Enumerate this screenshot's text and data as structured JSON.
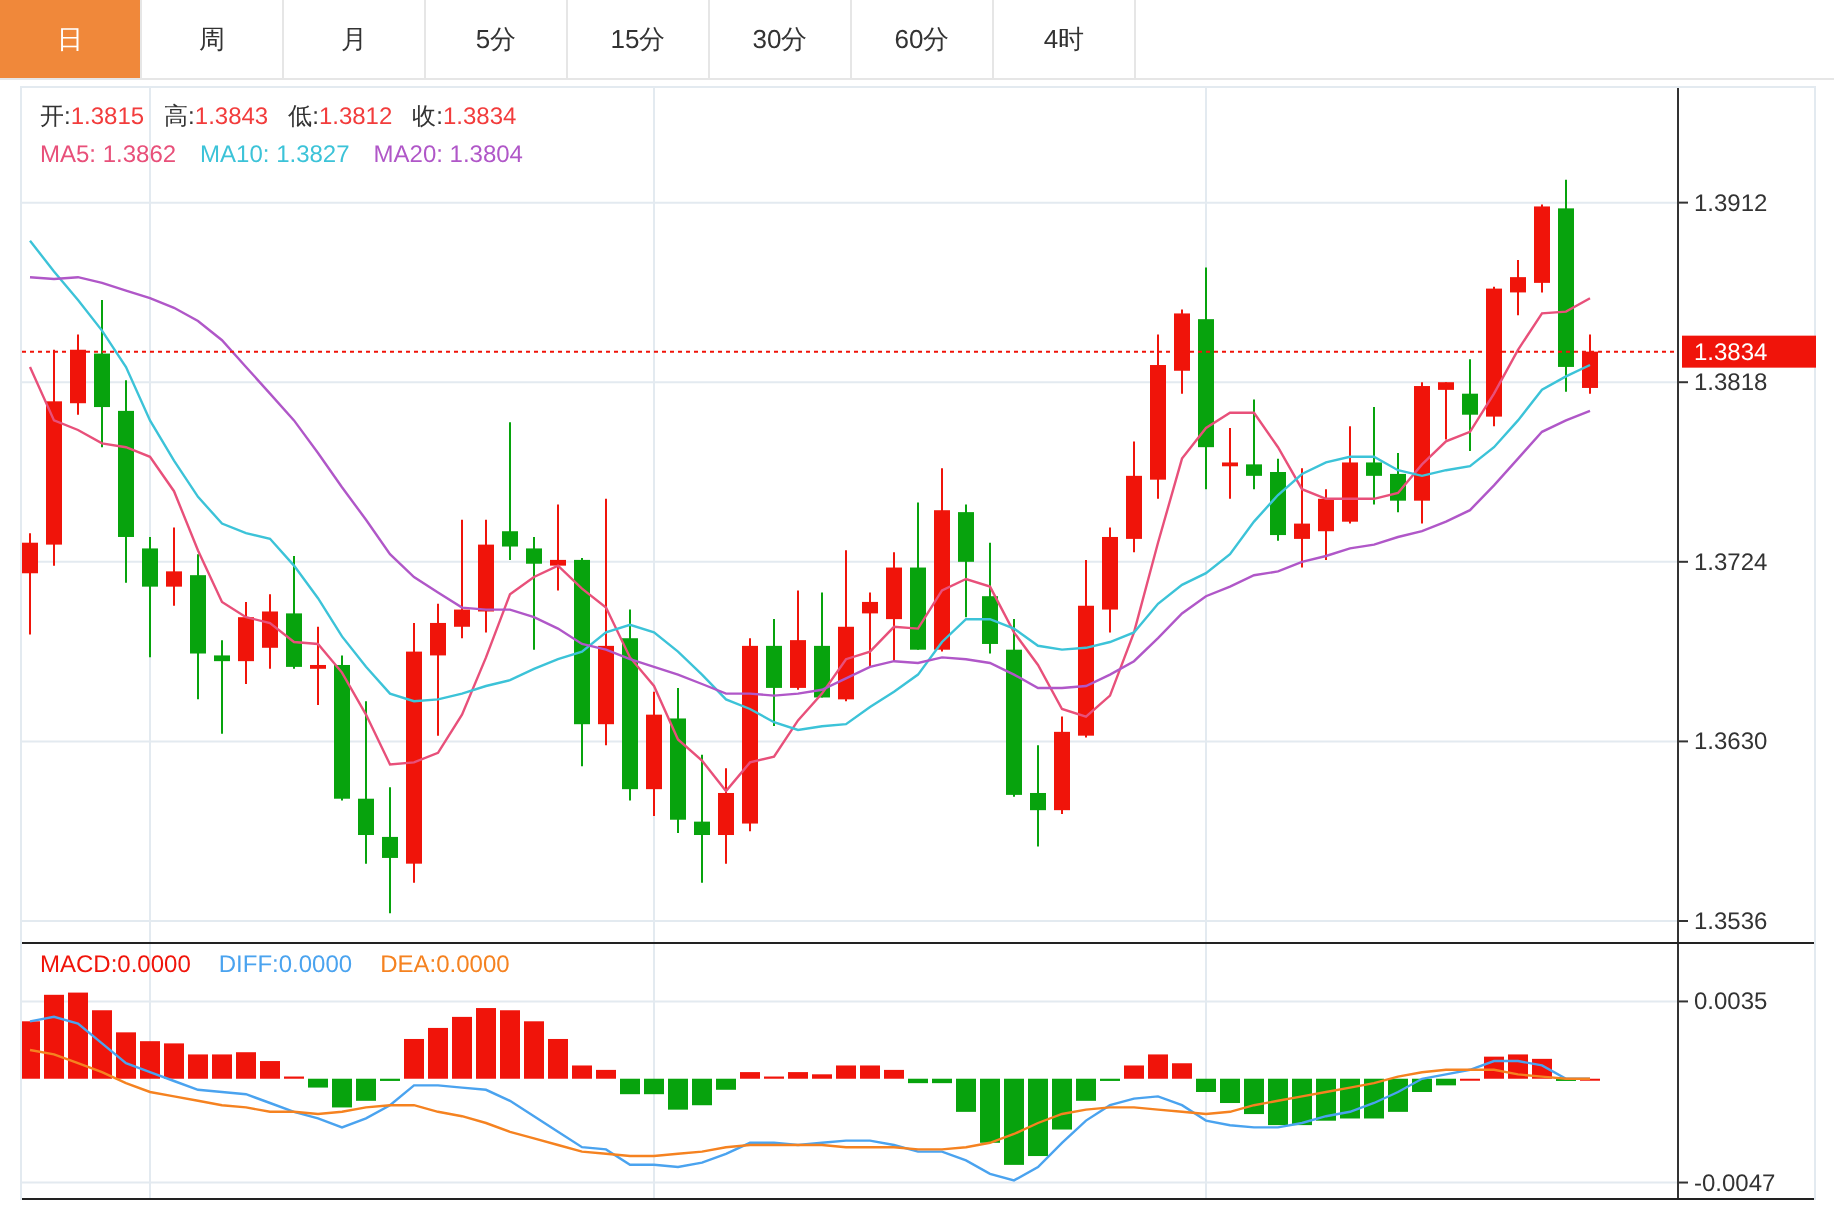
{
  "tabs": [
    {
      "label": "日",
      "selected": true
    },
    {
      "label": "周",
      "selected": false
    },
    {
      "label": "月",
      "selected": false
    },
    {
      "label": "5分",
      "selected": false
    },
    {
      "label": "15分",
      "selected": false
    },
    {
      "label": "30分",
      "selected": false
    },
    {
      "label": "60分",
      "selected": false
    },
    {
      "label": "4时",
      "selected": false
    }
  ],
  "main_chart": {
    "legend": {
      "ohlc": [
        {
          "label": "开:",
          "value": "1.3815"
        },
        {
          "label": "高:",
          "value": "1.3843"
        },
        {
          "label": "低:",
          "value": "1.3812"
        },
        {
          "label": "收:",
          "value": "1.3834"
        }
      ],
      "ma": [
        {
          "text": "MA5: 1.3862"
        },
        {
          "text": "MA10: 1.3827"
        },
        {
          "text": "MA20: 1.3804"
        }
      ]
    },
    "chart_data": {
      "type": "candlestick",
      "grid": true,
      "ref_lines": [
        {
          "axis": "y",
          "value": 1.3834,
          "label": "1.3834"
        }
      ],
      "ylim": [
        1.3525,
        1.3972
      ],
      "yticks": [
        {
          "value": 1.3912,
          "label": "1.3912"
        },
        {
          "value": 1.3818,
          "label": "1.3818"
        },
        {
          "value": 1.3724,
          "label": "1.3724"
        },
        {
          "value": 1.363,
          "label": "1.3630"
        },
        {
          "value": 1.3536,
          "label": "1.3536"
        }
      ],
      "ohlc": [
        [
          1.3718,
          1.3739,
          1.3686,
          1.3734
        ],
        [
          1.3733,
          1.3835,
          1.3722,
          1.3808
        ],
        [
          1.3807,
          1.3843,
          1.3801,
          1.3835
        ],
        [
          1.3833,
          1.3861,
          1.3784,
          1.3805
        ],
        [
          1.3803,
          1.3819,
          1.3713,
          1.3737
        ],
        [
          1.3731,
          1.3737,
          1.3674,
          1.3711
        ],
        [
          1.3711,
          1.3742,
          1.3701,
          1.3719
        ],
        [
          1.3717,
          1.3728,
          1.3652,
          1.3676
        ],
        [
          1.3675,
          1.3683,
          1.3634,
          1.3672
        ],
        [
          1.3672,
          1.3703,
          1.366,
          1.3695
        ],
        [
          1.3679,
          1.3707,
          1.3668,
          1.3698
        ],
        [
          1.3697,
          1.3727,
          1.3668,
          1.3669
        ],
        [
          1.3668,
          1.369,
          1.3649,
          1.367
        ],
        [
          1.367,
          1.3675,
          1.3599,
          1.36
        ],
        [
          1.36,
          1.3651,
          1.3566,
          1.3581
        ],
        [
          1.358,
          1.3606,
          1.354,
          1.3569
        ],
        [
          1.3566,
          1.3692,
          1.3556,
          1.3677
        ],
        [
          1.3675,
          1.3702,
          1.3633,
          1.3692
        ],
        [
          1.369,
          1.3746,
          1.3684,
          1.3699
        ],
        [
          1.3698,
          1.3746,
          1.3687,
          1.3733
        ],
        [
          1.374,
          1.3797,
          1.3725,
          1.3732
        ],
        [
          1.3731,
          1.3737,
          1.3678,
          1.3723
        ],
        [
          1.3722,
          1.3754,
          1.3709,
          1.3725
        ],
        [
          1.3725,
          1.3726,
          1.3617,
          1.3639
        ],
        [
          1.3639,
          1.3757,
          1.3628,
          1.368
        ],
        [
          1.3684,
          1.3699,
          1.3599,
          1.3605
        ],
        [
          1.3605,
          1.3656,
          1.3591,
          1.3644
        ],
        [
          1.3642,
          1.3658,
          1.3582,
          1.3589
        ],
        [
          1.3588,
          1.3623,
          1.3556,
          1.3581
        ],
        [
          1.3581,
          1.3616,
          1.3566,
          1.3603
        ],
        [
          1.3587,
          1.3684,
          1.3583,
          1.368
        ],
        [
          1.368,
          1.3694,
          1.3638,
          1.3658
        ],
        [
          1.3658,
          1.3709,
          1.3657,
          1.3683
        ],
        [
          1.368,
          1.3708,
          1.3653,
          1.3653
        ],
        [
          1.3652,
          1.373,
          1.3651,
          1.369
        ],
        [
          1.3697,
          1.3708,
          1.3669,
          1.3703
        ],
        [
          1.3694,
          1.3729,
          1.3672,
          1.3721
        ],
        [
          1.3721,
          1.3755,
          1.3678,
          1.3678
        ],
        [
          1.3678,
          1.3773,
          1.3677,
          1.3751
        ],
        [
          1.375,
          1.3754,
          1.3695,
          1.3724
        ],
        [
          1.3706,
          1.3734,
          1.3676,
          1.3681
        ],
        [
          1.3678,
          1.3694,
          1.3601,
          1.3602
        ],
        [
          1.3603,
          1.3628,
          1.3575,
          1.3594
        ],
        [
          1.3594,
          1.3643,
          1.3592,
          1.3635
        ],
        [
          1.3633,
          1.3725,
          1.3632,
          1.3701
        ],
        [
          1.3699,
          1.3742,
          1.3687,
          1.3737
        ],
        [
          1.3736,
          1.3787,
          1.3729,
          1.3769
        ],
        [
          1.3767,
          1.3843,
          1.3757,
          1.3827
        ],
        [
          1.3824,
          1.3856,
          1.3812,
          1.3854
        ],
        [
          1.3851,
          1.3878,
          1.3762,
          1.3784
        ],
        [
          1.3774,
          1.3794,
          1.3757,
          1.3776
        ],
        [
          1.3775,
          1.3809,
          1.3762,
          1.3769
        ],
        [
          1.3771,
          1.3778,
          1.3735,
          1.3738
        ],
        [
          1.3736,
          1.3773,
          1.3721,
          1.3744
        ],
        [
          1.374,
          1.3762,
          1.3725,
          1.3757
        ],
        [
          1.3745,
          1.3795,
          1.3744,
          1.3776
        ],
        [
          1.3776,
          1.3805,
          1.3754,
          1.3769
        ],
        [
          1.377,
          1.3781,
          1.375,
          1.3756
        ],
        [
          1.3756,
          1.3818,
          1.3744,
          1.3816
        ],
        [
          1.3814,
          1.3818,
          1.3788,
          1.3818
        ],
        [
          1.3812,
          1.383,
          1.3782,
          1.3801
        ],
        [
          1.38,
          1.3868,
          1.3795,
          1.3867
        ],
        [
          1.3865,
          1.3882,
          1.3853,
          1.3873
        ],
        [
          1.387,
          1.3911,
          1.3865,
          1.391
        ],
        [
          1.3909,
          1.3924,
          1.3813,
          1.3826
        ],
        [
          1.3815,
          1.3843,
          1.3812,
          1.3834
        ]
      ],
      "series": [
        {
          "type": "line",
          "color": "#e8507a",
          "values": [
            1.3826,
            1.3798,
            1.3793,
            1.3786,
            1.3784,
            1.3779,
            1.3761,
            1.373,
            1.3703,
            1.3695,
            1.3692,
            1.3682,
            1.3681,
            1.3666,
            1.3644,
            1.3618,
            1.3619,
            1.3624,
            1.3644,
            1.3674,
            1.3707,
            1.3716,
            1.3722,
            1.371,
            1.37,
            1.3674,
            1.3659,
            1.3631,
            1.362,
            1.3604,
            1.3619,
            1.3622,
            1.3641,
            1.3655,
            1.3673,
            1.3677,
            1.369,
            1.3689,
            1.3709,
            1.3715,
            1.3711,
            1.3687,
            1.367,
            1.3647,
            1.3643,
            1.3654,
            1.3687,
            1.3734,
            1.3778,
            1.3794,
            1.3802,
            1.3802,
            1.3784,
            1.3762,
            1.3757,
            1.3757,
            1.3757,
            1.376,
            1.3775,
            1.3787,
            1.3792,
            1.3812,
            1.3835,
            1.3854,
            1.3855,
            1.3862
          ]
        },
        {
          "type": "line",
          "color": "#3cc3d8",
          "values": [
            1.3892,
            1.3876,
            1.3861,
            1.3845,
            1.3826,
            1.3798,
            1.3777,
            1.3758,
            1.3744,
            1.3739,
            1.3736,
            1.3722,
            1.3705,
            1.3685,
            1.3669,
            1.3655,
            1.3651,
            1.3652,
            1.3655,
            1.3659,
            1.3662,
            1.3668,
            1.3673,
            1.3677,
            1.3687,
            1.3691,
            1.3687,
            1.3677,
            1.3665,
            1.3652,
            1.3647,
            1.364,
            1.3636,
            1.3638,
            1.3639,
            1.3648,
            1.3656,
            1.3665,
            1.3682,
            1.3694,
            1.3694,
            1.3689,
            1.368,
            1.3678,
            1.3679,
            1.3682,
            1.3687,
            1.3702,
            1.3712,
            1.3718,
            1.3728,
            1.3745,
            1.3759,
            1.377,
            1.3776,
            1.3779,
            1.3779,
            1.3772,
            1.3769,
            1.3772,
            1.3774,
            1.3784,
            1.3798,
            1.3814,
            1.3821,
            1.3827
          ]
        },
        {
          "type": "line",
          "color": "#b057c8",
          "values": [
            1.3873,
            1.3872,
            1.3873,
            1.387,
            1.3866,
            1.3862,
            1.3857,
            1.385,
            1.384,
            1.3826,
            1.3812,
            1.3798,
            1.3781,
            1.3763,
            1.3746,
            1.3728,
            1.3716,
            1.3708,
            1.37,
            1.3699,
            1.3699,
            1.3695,
            1.3689,
            1.3681,
            1.3678,
            1.3673,
            1.3669,
            1.3665,
            1.366,
            1.3655,
            1.3655,
            1.3654,
            1.3655,
            1.3657,
            1.3663,
            1.3669,
            1.3672,
            1.3671,
            1.3674,
            1.3673,
            1.3671,
            1.3665,
            1.3658,
            1.3658,
            1.3659,
            1.3665,
            1.3672,
            1.3684,
            1.3697,
            1.3706,
            1.3711,
            1.3717,
            1.3719,
            1.3724,
            1.3727,
            1.3731,
            1.3733,
            1.3737,
            1.374,
            1.3745,
            1.3751,
            1.3764,
            1.3778,
            1.3792,
            1.3798,
            1.3803
          ]
        }
      ]
    }
  },
  "macd_chart": {
    "legend": [
      {
        "text": "MACD:0.0000"
      },
      {
        "text": "DIFF:0.0000"
      },
      {
        "text": "DEA:0.0000"
      }
    ],
    "chart_data": {
      "type": "bar",
      "grid": true,
      "stacked": true,
      "ylim": [
        -0.0054,
        0.0061
      ],
      "yticks": [
        {
          "value": 0.0035,
          "label": "0.0035"
        },
        {
          "value": -0.0047,
          "label": "-0.0047"
        }
      ],
      "series": [
        {
          "color": "#f0140a",
          "values": [
            0.0026,
            0.0038,
            0.0039,
            0.0031,
            0.0021,
            0.0017,
            0.0016,
            0.0011,
            0.0011,
            0.0012,
            0.0008,
            0.0001,
            null,
            null,
            null,
            null,
            0.0018,
            0.0023,
            0.0028,
            0.0032,
            0.0031,
            0.0026,
            0.0018,
            0.0006,
            0.0004,
            null,
            null,
            null,
            null,
            null,
            0.0003,
            0.0001,
            0.0003,
            0.0002,
            0.0006,
            0.0006,
            0.0004,
            null,
            null,
            null,
            null,
            null,
            null,
            null,
            null,
            null,
            0.0006,
            0.0011,
            0.0007,
            null,
            null,
            null,
            null,
            null,
            null,
            null,
            null,
            null,
            null,
            null,
            0,
            0.001,
            0.0011,
            0.0009,
            null,
            0
          ]
        },
        {
          "color": "#07a30d",
          "values": [
            null,
            null,
            null,
            null,
            null,
            null,
            null,
            null,
            null,
            null,
            null,
            null,
            -0.0004,
            -0.0013,
            -0.001,
            -0.0001,
            null,
            null,
            null,
            null,
            null,
            null,
            null,
            null,
            null,
            -0.0007,
            -0.0007,
            -0.0014,
            -0.0012,
            -0.0005,
            null,
            null,
            null,
            null,
            null,
            null,
            null,
            -0.0002,
            -0.0002,
            -0.0015,
            -0.0029,
            -0.0039,
            -0.0035,
            -0.0023,
            -0.001,
            -0.0001,
            null,
            null,
            null,
            -0.0006,
            -0.0011,
            -0.0016,
            -0.0021,
            -0.0021,
            -0.0019,
            -0.0018,
            -0.0018,
            -0.0015,
            -0.0006,
            -0.0003,
            null,
            null,
            null,
            null,
            -0.0001,
            null
          ]
        },
        {
          "type": "line",
          "color": "#4aa3ef",
          "values": [
            0.0026,
            0.0028,
            0.0025,
            0.0016,
            0.0007,
            0.0003,
            -0.0001,
            -0.0005,
            -0.0006,
            -0.0007,
            -0.0011,
            -0.0015,
            -0.0018,
            -0.0022,
            -0.0018,
            -0.0012,
            -0.0003,
            -0.0003,
            -0.0004,
            -0.0005,
            -0.001,
            -0.0017,
            -0.0024,
            -0.0031,
            -0.0032,
            -0.0039,
            -0.0039,
            -0.004,
            -0.0038,
            -0.0034,
            -0.0029,
            -0.0029,
            -0.003,
            -0.0029,
            -0.0028,
            -0.0028,
            -0.003,
            -0.0033,
            -0.0033,
            -0.0037,
            -0.0043,
            -0.0046,
            -0.004,
            -0.0029,
            -0.0019,
            -0.0012,
            -0.0009,
            -0.0008,
            -0.0012,
            -0.0019,
            -0.0021,
            -0.0022,
            -0.0022,
            -0.002,
            -0.0017,
            -0.0015,
            -0.0011,
            -0.0006,
            0,
            0.0002,
            0.0004,
            0.0008,
            0.0008,
            0.0006,
            0,
            0
          ]
        },
        {
          "type": "line",
          "color": "#f58220",
          "values": [
            0.0013,
            0.0011,
            0.0007,
            0.0003,
            -0.0002,
            -0.0006,
            -0.0008,
            -0.001,
            -0.0012,
            -0.0013,
            -0.0015,
            -0.0015,
            -0.0016,
            -0.0015,
            -0.0013,
            -0.0012,
            -0.0012,
            -0.0015,
            -0.0017,
            -0.002,
            -0.0024,
            -0.0027,
            -0.003,
            -0.0033,
            -0.0034,
            -0.0035,
            -0.0035,
            -0.0034,
            -0.0033,
            -0.0031,
            -0.003,
            -0.003,
            -0.003,
            -0.003,
            -0.0031,
            -0.0031,
            -0.0031,
            -0.0032,
            -0.0032,
            -0.0031,
            -0.0029,
            -0.0025,
            -0.002,
            -0.0016,
            -0.0014,
            -0.0013,
            -0.0013,
            -0.0014,
            -0.0015,
            -0.0016,
            -0.0015,
            -0.0012,
            -0.001,
            -0.0008,
            -0.0006,
            -0.0004,
            -0.0002,
            0.0001,
            0.0003,
            0.0004,
            0.0004,
            0.0004,
            0.0002,
            0.0001,
            0,
            0
          ]
        }
      ]
    }
  }
}
